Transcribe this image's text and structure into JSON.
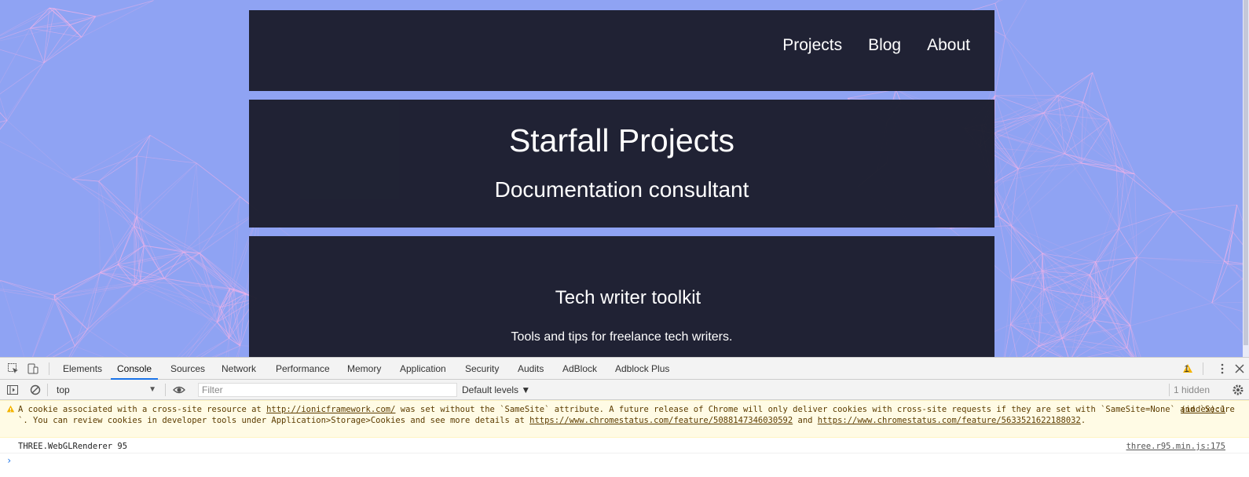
{
  "site": {
    "nav": [
      "Projects",
      "Blog",
      "About"
    ],
    "hero_title": "Starfall Projects",
    "hero_subtitle": "Documentation consultant",
    "card_title": "Tech writer toolkit",
    "card_text": "Tools and tips for freelance tech writers."
  },
  "colors": {
    "page_bg": "#8fa3f3",
    "panel_bg": "#1e2030",
    "network_lines": "#f4b3e8",
    "link_accent": "#1a73e8"
  },
  "devtools": {
    "tabs": [
      "Elements",
      "Console",
      "Sources",
      "Network",
      "Performance",
      "Memory",
      "Application",
      "Security",
      "Audits",
      "AdBlock",
      "Adblock Plus"
    ],
    "active_tab": "Console",
    "warning_count": "1",
    "context": "top",
    "filter_placeholder": "Filter",
    "levels": "Default levels",
    "hidden": "1 hidden",
    "messages": {
      "warning": {
        "pre": "A cookie associated with a cross-site resource at ",
        "link1": "http://ionicframework.com/",
        "mid": " was set without the `SameSite` attribute. A future release of Chrome will only deliver cookies with cross-site requests if they are set with `SameSite=None` and `Secure`. You can review cookies in developer tools under Application>Storage>Cookies and see more details at ",
        "link2": "https://www.chromestatus.com/feature/5088147346030592",
        "and": " and ",
        "link3": "https://www.chromestatus.com/feature/5633521622188032",
        "end": ".",
        "source": "(index):1"
      },
      "log": {
        "text": "THREE.WebGLRenderer 95",
        "source": "three.r95.min.js:175"
      }
    },
    "prompt": "›"
  }
}
